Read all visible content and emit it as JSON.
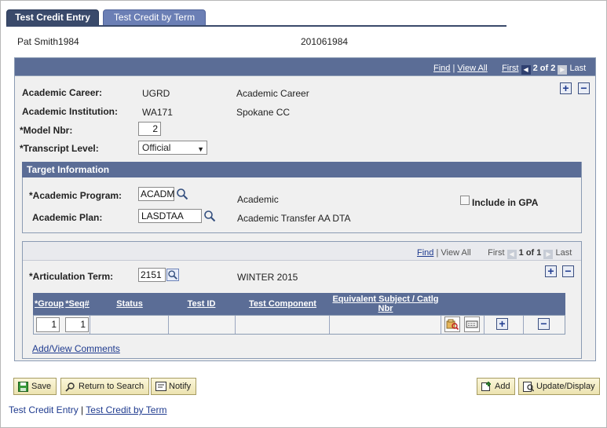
{
  "tabs": {
    "active": "Test Credit Entry",
    "inactive": "Test Credit by Term"
  },
  "header": {
    "name": "Pat Smith1984",
    "id": "201061984"
  },
  "nav_top": {
    "find": "Find",
    "sep": "|",
    "view_all": "View All",
    "first": "First",
    "prev_arrow": "◀",
    "count": "2 of 2",
    "next_arrow": "▶",
    "last": "Last"
  },
  "fields": {
    "academic_career_label": "Academic Career:",
    "academic_career_value": "UGRD",
    "academic_career_desc": "Academic Career",
    "academic_institution_label": "Academic Institution:",
    "academic_institution_value": "WA171",
    "academic_institution_desc": "Spokane CC",
    "model_nbr_label": "*Model Nbr:",
    "model_nbr_value": "2",
    "transcript_level_label": "*Transcript Level:",
    "transcript_level_value": "Official"
  },
  "target": {
    "title": "Target Information",
    "program_label": "*Academic Program:",
    "program_value": "ACADM",
    "program_desc": "Academic",
    "plan_label": "Academic Plan:",
    "plan_value": "LASDTAA",
    "plan_desc": "Academic Transfer AA DTA",
    "gpa_label": "Include in GPA"
  },
  "nav_inner": {
    "find": "Find",
    "sep": "|",
    "view_all": "View All",
    "first": "First",
    "prev_arrow": "◀",
    "count": "1 of 1",
    "next_arrow": "▶",
    "last": "Last"
  },
  "articulation": {
    "label": "*Articulation Term:",
    "value": "2151",
    "desc": "WINTER 2015"
  },
  "grid": {
    "headers": [
      "*Group",
      "*Seq#",
      "Status",
      "Test ID",
      "Test Component",
      "Equivalent Subject / Catlg Nbr"
    ],
    "row": {
      "group": "1",
      "seq": "1"
    }
  },
  "add_view_comments": "Add/View Comments",
  "buttons": {
    "save": "Save",
    "return_to_search": "Return to Search",
    "notify": "Notify",
    "add": "Add",
    "update_display": "Update/Display"
  },
  "footer": {
    "link1": "Test Credit Entry",
    "sep": "|",
    "link2": "Test Credit by Term"
  },
  "icons": {
    "lookup": "magnifier-icon",
    "add_row": "plus-icon",
    "delete_row": "minus-icon"
  },
  "colors": {
    "header_bar": "#5b6d96",
    "active_tab": "#3a4a6b",
    "link": "#1f3b8f"
  }
}
